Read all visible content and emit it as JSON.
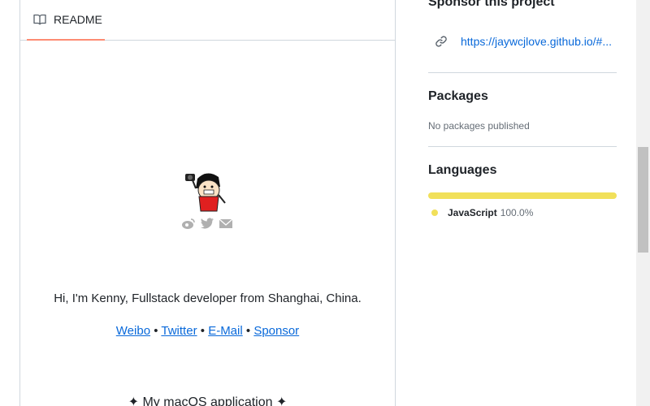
{
  "readme": {
    "tab_label": "README",
    "intro": "Hi, I'm Kenny, Fullstack developer from Shanghai, China.",
    "links": {
      "weibo": "Weibo",
      "twitter": "Twitter",
      "email": "E-Mail",
      "sponsor": "Sponsor",
      "separator": "•"
    },
    "macos_heading": "✦ My macOS application ✦",
    "social_icons": [
      "weibo-icon",
      "twitter-icon",
      "mail-icon"
    ]
  },
  "sidebar": {
    "sponsor": {
      "title": "Sponsor this project",
      "link": "https://jaywcjlove.github.io/#..."
    },
    "packages": {
      "title": "Packages",
      "empty_text": "No packages published"
    },
    "languages": {
      "title": "Languages",
      "items": [
        {
          "name": "JavaScript",
          "percent": "100.0%",
          "color": "#f1e05a"
        }
      ]
    }
  },
  "colors": {
    "accent_link": "#0969da",
    "tab_underline": "#fd8c73",
    "border": "#d0d7de",
    "muted_text": "#656d76"
  }
}
